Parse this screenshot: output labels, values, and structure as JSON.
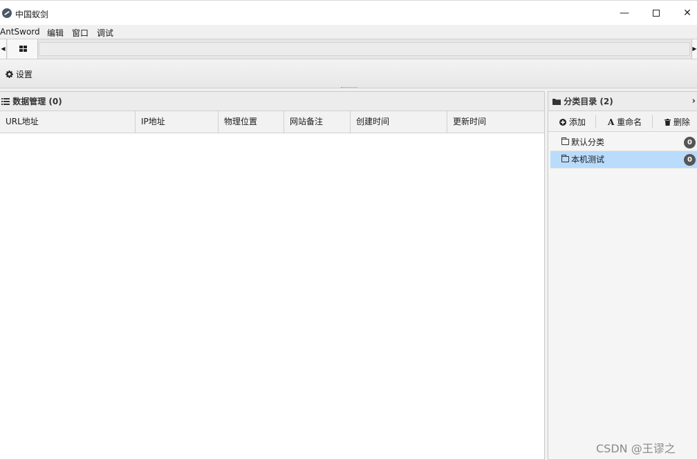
{
  "window": {
    "title": "中国蚁剑",
    "minimize": "—",
    "close": "✕"
  },
  "menu": [
    "AntSword",
    "编辑",
    "窗口",
    "调试"
  ],
  "tabbar": {
    "left_arrow": "◀",
    "right_arrow": "▶"
  },
  "toolbar": {
    "settings_label": "设置"
  },
  "data_panel": {
    "title": "数据管理 (0)",
    "columns": [
      "URL地址",
      "IP地址",
      "物理位置",
      "网站备注",
      "创建时间",
      "更新时间"
    ]
  },
  "category_panel": {
    "title": "分类目录 (2)",
    "chevron": "›",
    "buttons": {
      "add": "添加",
      "rename": "重命名",
      "delete": "删除"
    },
    "items": [
      {
        "name": "默认分类",
        "count": "0",
        "selected": false
      },
      {
        "name": "本机测试",
        "count": "0",
        "selected": true
      }
    ]
  },
  "watermark": "CSDN @王谬之",
  "colors": {
    "selected_row": "#b9dbfc",
    "badge": "#555555"
  }
}
